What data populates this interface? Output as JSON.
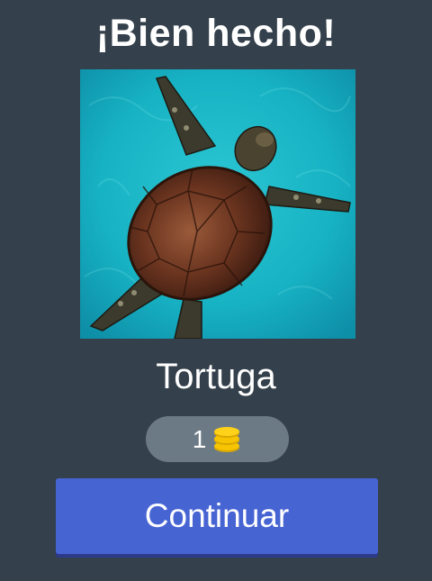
{
  "header": {
    "title": "¡Bien hecho!"
  },
  "question": {
    "image_subject": "sea-turtle"
  },
  "result": {
    "answer": "Tortuga"
  },
  "reward": {
    "count": "1",
    "icon": "coins-icon",
    "coin_color": "#f6c400"
  },
  "actions": {
    "continue_label": "Continuar"
  },
  "colors": {
    "background": "#34414c",
    "pill": "#6c7a86",
    "button": "#4764d3"
  }
}
